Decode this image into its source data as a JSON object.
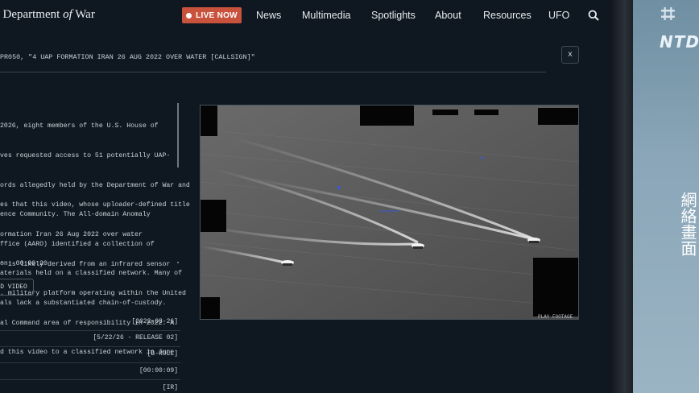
{
  "header": {
    "site_title_prefix": ". Department",
    "site_title_of": "of",
    "site_title_suffix": "War",
    "live_label": "LIVE NOW",
    "nav": [
      "News",
      "Multimedia",
      "Spotlights",
      "About",
      "Resources",
      "UFO"
    ]
  },
  "clip": {
    "id_text": "PR050, \"4 UAP FORMATION IRAN 26 AUG 2022 OVER WATER [CALLSIGN]\"",
    "close_label": "x",
    "paragraph1": [
      "2026, eight members of the U.S. House of",
      "ves requested access to 51 potentially UAP-",
      "ords allegedly held by the Department of War and",
      "ence Community. The All-domain Anomaly",
      "ffice (AARO) identified a collection of",
      "aterials held on a classified network. Many of",
      "als lack a substantiated chain-of-custody."
    ],
    "paragraph2": [
      "es that this video, whose uploader-defined title",
      "ormation Iran 26 Aug 2022 over water",
      "' is likely derived from an infrared sensor",
      ". military platform operating within the United",
      "al Command area of responsibility in 2022. A",
      "d this video to a classified network in June"
    ],
    "duration_line": "on: 00:00:20",
    "video_button": "D VIDEO",
    "meta": [
      "[2022-08-26]",
      "[5/22/26 - RELEASE 02]",
      "[B-ROLL]",
      "[00:00:09]",
      "[IR]"
    ],
    "video_watermark": "PLAY FOOTAGE"
  },
  "broadcast": {
    "channel_logo": "NTD",
    "side_caption": "網絡畫面"
  },
  "colors": {
    "live_button": "#c9523d",
    "page_background": "#0f1820",
    "text": "#c9d1d8"
  }
}
